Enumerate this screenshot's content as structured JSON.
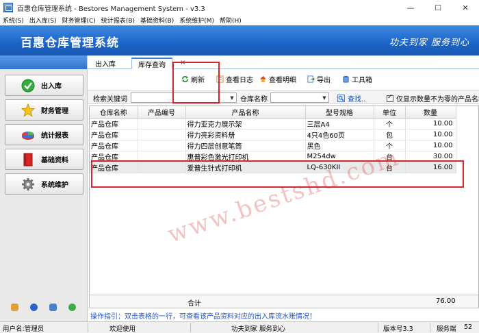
{
  "window": {
    "title": "百惠仓库管理系统 - Bestores Management System - v3.3",
    "minimize": "—",
    "maximize": "☐",
    "close": "✕"
  },
  "menubar": [
    "系统(S)",
    "出入库(S)",
    "财务管理(C)",
    "统计报表(B)",
    "基础资料(B)",
    "系统维护(M)",
    "帮助(H)"
  ],
  "banner": {
    "brand": "百惠仓库管理系统",
    "slogan": "功夫到家 服务到心",
    "background": "#1c64c7"
  },
  "sidebar": {
    "items": [
      {
        "label": "出入库",
        "icon": "check-circle-icon"
      },
      {
        "label": "财务管理",
        "icon": "star-icon"
      },
      {
        "label": "统计报表",
        "icon": "pie-chart-icon"
      },
      {
        "label": "基础资料",
        "icon": "book-icon"
      },
      {
        "label": "系统维护",
        "icon": "gear-icon"
      }
    ]
  },
  "tabs": [
    {
      "label": "出入库"
    },
    {
      "label": "库存查询",
      "active": true
    }
  ],
  "tab_close": "×",
  "toolbar": {
    "refresh": "刷新",
    "view_log": "查看日志",
    "view_detail": "查看明细",
    "export": "导出",
    "toolbox": "工具箱"
  },
  "search": {
    "keyword_label": "检索关键词",
    "keyword_value": "",
    "warehouse_label": "仓库名称",
    "warehouse_value": "",
    "find_label": "查找..",
    "checkbox_label": "仅显示数量不为零的产品名称",
    "checkbox_checked": true
  },
  "table": {
    "columns": [
      "仓库名称",
      "产品编号",
      "产品名称",
      "型号规格",
      "单位",
      "数量"
    ],
    "rows": [
      [
        "产品仓库",
        "",
        "得力亚克力展示架",
        "三层A4",
        "个",
        "10.00"
      ],
      [
        "产品仓库",
        "",
        "得力亮彩资料册",
        "4只4色60页",
        "包",
        "10.00"
      ],
      [
        "产品仓库",
        "",
        "得力四层创意笔筒",
        "黑色",
        "个",
        "10.00"
      ],
      [
        "产品仓库",
        "",
        "惠普彩色激光打印机",
        "M254dw",
        "台",
        "30.00"
      ],
      [
        "产品仓库",
        "",
        "爱普生针式打印机",
        "LQ-630KII",
        "台",
        "16.00"
      ]
    ],
    "selected_row": 4,
    "total_label": "合计",
    "total_value": "76.00"
  },
  "hint": "操作指引：双击表格的一行，可查看该产品资料对应的出入库流水账情况！",
  "watermark": "www.bestshd.com",
  "statusbar": {
    "user": "用户名:管理员",
    "welcome": "欢迎使用",
    "slogan": "功夫到家 服务到心",
    "version": "版本号3.3",
    "service": "服务端",
    "number": "52"
  },
  "colors": {
    "accent": "#1c64c7",
    "annotation": "#d5252f",
    "hint_text": "#1e52c8"
  }
}
